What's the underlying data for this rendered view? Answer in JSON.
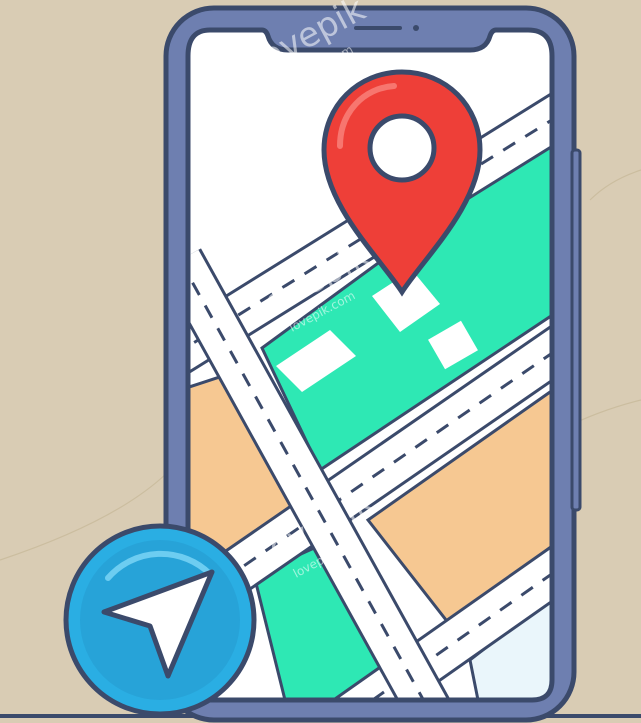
{
  "watermark": {
    "brand": "Lovepik",
    "url": "lovepik.com"
  },
  "colors": {
    "background": "#d9ccb4",
    "outline": "#3b4a6b",
    "phone_frame": "#6e7fb0",
    "screen": "#ffffff",
    "park": "#2ee8b4",
    "block": "#f6c892",
    "water": "#eaf6fb",
    "road": "#ffffff",
    "pin": "#ee3f38",
    "nav_button": "#2aaee3",
    "nav_arrow": "#ffffff"
  },
  "icons": {
    "pin": "map-pin-icon",
    "navigation": "navigation-arrow-icon"
  }
}
